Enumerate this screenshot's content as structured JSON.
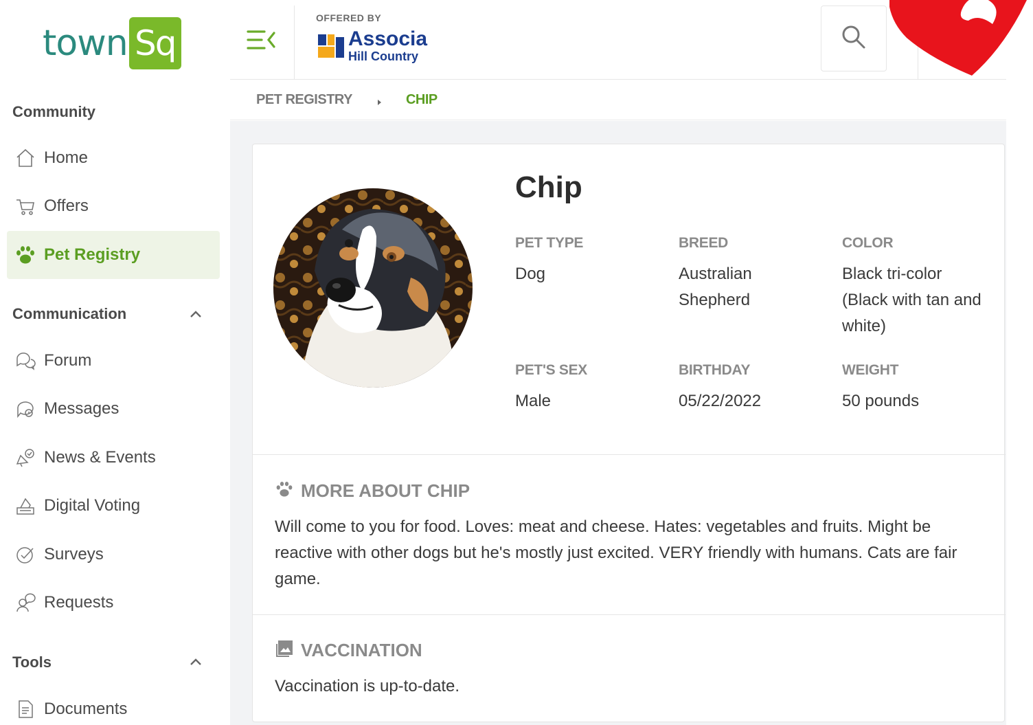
{
  "brand": {
    "logo_text": "town",
    "logo_box_text": "Sq",
    "offered_by": "OFFERED BY",
    "partner_name": "Associa",
    "partner_sub": "Hill Country",
    "accent_color": "#7ab92a",
    "partner_color": "#1b3d8f"
  },
  "sidebar": {
    "sections": [
      {
        "title": "Community"
      },
      {
        "title": "Communication"
      },
      {
        "title": "Tools"
      }
    ],
    "items": [
      {
        "label": "Home",
        "icon": "home-icon"
      },
      {
        "label": "Offers",
        "icon": "cart-icon"
      },
      {
        "label": "Pet Registry",
        "icon": "paw-icon",
        "active": true
      },
      {
        "label": "Forum",
        "icon": "chat-bubbles-icon"
      },
      {
        "label": "Messages",
        "icon": "message-icon"
      },
      {
        "label": "News & Events",
        "icon": "megaphone-icon"
      },
      {
        "label": "Digital Voting",
        "icon": "ballot-box-icon"
      },
      {
        "label": "Surveys",
        "icon": "check-circle-icon"
      },
      {
        "label": "Requests",
        "icon": "request-icon"
      },
      {
        "label": "Documents",
        "icon": "document-icon"
      }
    ]
  },
  "breadcrumb": {
    "parent": "PET REGISTRY",
    "current": "CHIP"
  },
  "pet": {
    "name": "Chip",
    "fields": [
      {
        "label": "PET TYPE",
        "value": "Dog"
      },
      {
        "label": "BREED",
        "value": "Australian Shepherd"
      },
      {
        "label": "COLOR",
        "value": "Black tri-color (Black with tan and white)"
      },
      {
        "label": "PET'S SEX",
        "value": "Male"
      },
      {
        "label": "BIRTHDAY",
        "value": "05/22/2022"
      },
      {
        "label": "WEIGHT",
        "value": "50 pounds"
      }
    ],
    "more_title": "MORE ABOUT CHIP",
    "more_text": "Will come to you for food. Loves: meat and cheese. Hates: vegetables and fruits. Might be reactive with other dogs but he's mostly just excited. VERY friendly with humans. Cats are fair game.",
    "vaccination_title": "VACCINATION",
    "vaccination_text": "Vaccination is up-to-date."
  }
}
